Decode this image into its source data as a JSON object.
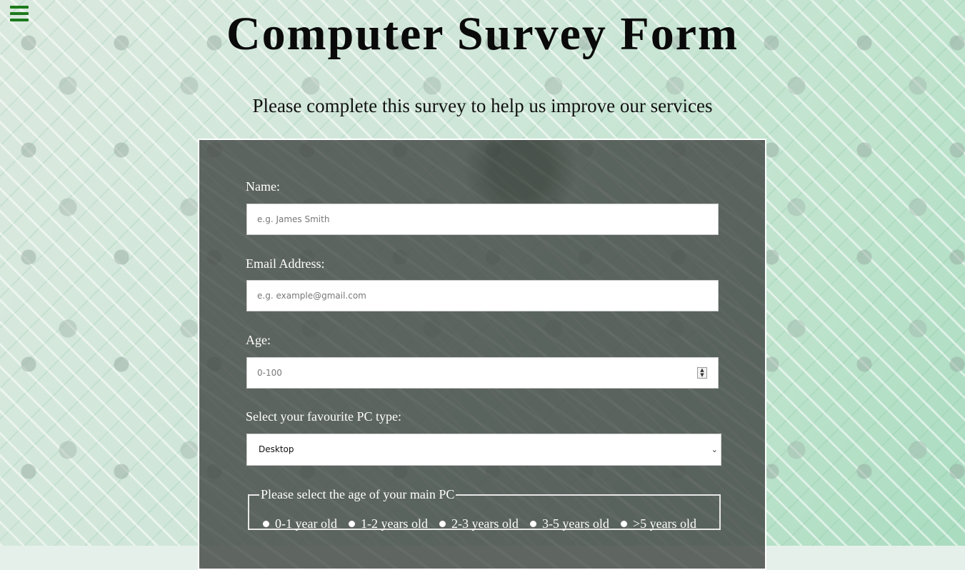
{
  "header": {
    "title": "Computer Survey Form",
    "subtitle": "Please complete this survey to help us improve our services"
  },
  "form": {
    "name": {
      "label": "Name:",
      "placeholder": "e.g. James Smith",
      "value": ""
    },
    "email": {
      "label": "Email Address:",
      "placeholder": "e.g. example@gmail.com",
      "value": ""
    },
    "age": {
      "label": "Age:",
      "placeholder": "0-100",
      "value": ""
    },
    "pc_type": {
      "label": "Select your favourite PC type:",
      "selected": "Desktop"
    },
    "pc_age": {
      "legend": "Please select the age of your main PC",
      "options": [
        "0-1 year old",
        "1-2 years old",
        "2-3 years old",
        "3-5 years old",
        ">5 years old"
      ]
    }
  },
  "icons": {
    "menu": "hamburger-menu-icon",
    "select": "chevron-down-icon",
    "spinner": "spin-arrows-icon"
  },
  "colors": {
    "menu_icon": "#1c7a1c",
    "form_bg": "#484e4a",
    "form_border": "#ffffff"
  }
}
